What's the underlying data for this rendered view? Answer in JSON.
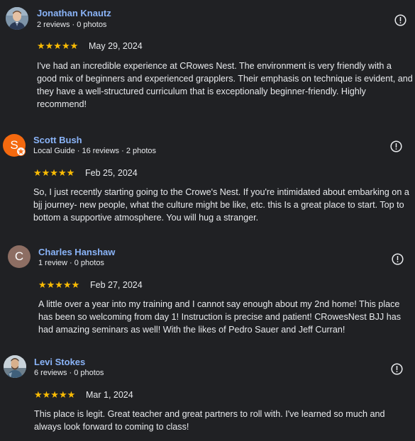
{
  "colors": {
    "background": "#202124",
    "name": "#8ab4f8",
    "text": "#e8eaed",
    "star": "#fbbc04",
    "scott_avatar": "#f4690f",
    "charles_avatar": "#8d6e63"
  },
  "reviews": [
    {
      "name": "Jonathan Knautz",
      "meta": "2 reviews · 0 photos",
      "stars": "★★★★★",
      "rating": 5,
      "date": "May 29, 2024",
      "text": "I've had an incredible experience at CRowes Nest. The environment is very friendly with a good mix of beginners and experienced grapplers. Their emphasis on technique is evident, and they have a well-structured curriculum that is exceptionally beginner-friendly. Highly recommend!",
      "avatar_icon": "person-photo-icon"
    },
    {
      "name": "Scott Bush",
      "meta": "Local Guide · 16 reviews · 2 photos",
      "stars": "★★★★★",
      "rating": 5,
      "date": "Feb 25, 2024",
      "text": "So, I just recently starting going to the Crowe's Nest. If you're intimidated about embarking on a bjj journey- new people, what the culture might be like, etc. this Is a great place to start. Top to bottom a supportive atmosphere. You will hug a stranger.",
      "avatar_letter": "S",
      "avatar_icon": "local-guide-star-icon"
    },
    {
      "name": "Charles Hanshaw",
      "meta": "1 review · 0 photos",
      "stars": "★★★★★",
      "rating": 5,
      "date": "Feb 27, 2024",
      "text": "A little over a year into my training and I cannot say enough about my 2nd home! This place has been so welcoming from day 1! Instruction is precise and patient! CRowesNest BJJ has had amazing seminars as well! With the likes of Pedro Sauer and Jeff Curran!",
      "avatar_letter": "C"
    },
    {
      "name": "Levi Stokes",
      "meta": "6 reviews · 0 photos",
      "stars": "★★★★★",
      "rating": 5,
      "date": "Mar 1, 2024",
      "text": "This place is legit. Great teacher and great partners to roll with. I've learned so much and always look forward to coming to class!",
      "avatar_icon": "person-photo-icon"
    }
  ],
  "more_icon": "report-info-icon"
}
